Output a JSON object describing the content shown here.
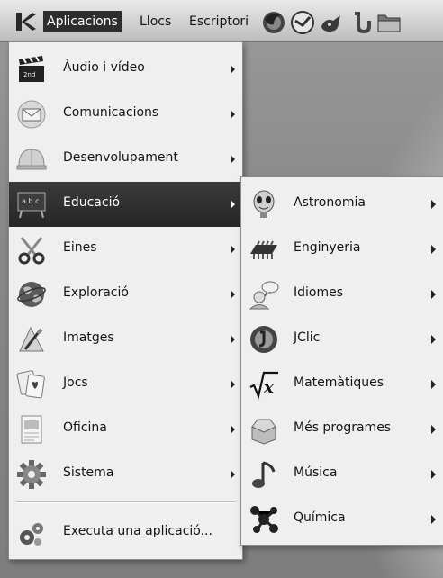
{
  "panel": {
    "menus": [
      "Aplicacions",
      "Llocs",
      "Escriptori"
    ],
    "launchers": [
      "firefox-icon",
      "thunderbird-icon",
      "gimp-icon",
      "jclic-icon",
      "folder-icon"
    ]
  },
  "main_menu": {
    "items": [
      {
        "label": "Àudio i vídeo",
        "icon": "clapperboard-icon",
        "has_submenu": true
      },
      {
        "label": "Comunicacions",
        "icon": "envelope-icon",
        "has_submenu": true
      },
      {
        "label": "Desenvolupament",
        "icon": "hardhat-icon",
        "has_submenu": true
      },
      {
        "label": "Educació",
        "icon": "chalkboard-icon",
        "has_submenu": true,
        "selected": true
      },
      {
        "label": "Eines",
        "icon": "scissors-icon",
        "has_submenu": true
      },
      {
        "label": "Exploració",
        "icon": "globe-icon",
        "has_submenu": true
      },
      {
        "label": "Imatges",
        "icon": "paintbrush-icon",
        "has_submenu": true
      },
      {
        "label": "Jocs",
        "icon": "playing-cards-icon",
        "has_submenu": true
      },
      {
        "label": "Oficina",
        "icon": "document-icon",
        "has_submenu": true
      },
      {
        "label": "Sistema",
        "icon": "gear-icon",
        "has_submenu": true
      }
    ],
    "run_label": "Executa una aplicació..."
  },
  "sub_menu": {
    "items": [
      {
        "label": "Astronomia",
        "icon": "alien-icon"
      },
      {
        "label": "Enginyeria",
        "icon": "chip-icon"
      },
      {
        "label": "Idiomes",
        "icon": "speech-person-icon"
      },
      {
        "label": "JClic",
        "icon": "jclic-icon"
      },
      {
        "label": "Matemàtiques",
        "icon": "sqrt-icon"
      },
      {
        "label": "Més programes",
        "icon": "box-icon"
      },
      {
        "label": "Música",
        "icon": "music-note-icon"
      },
      {
        "label": "Química",
        "icon": "molecule-icon"
      }
    ]
  }
}
